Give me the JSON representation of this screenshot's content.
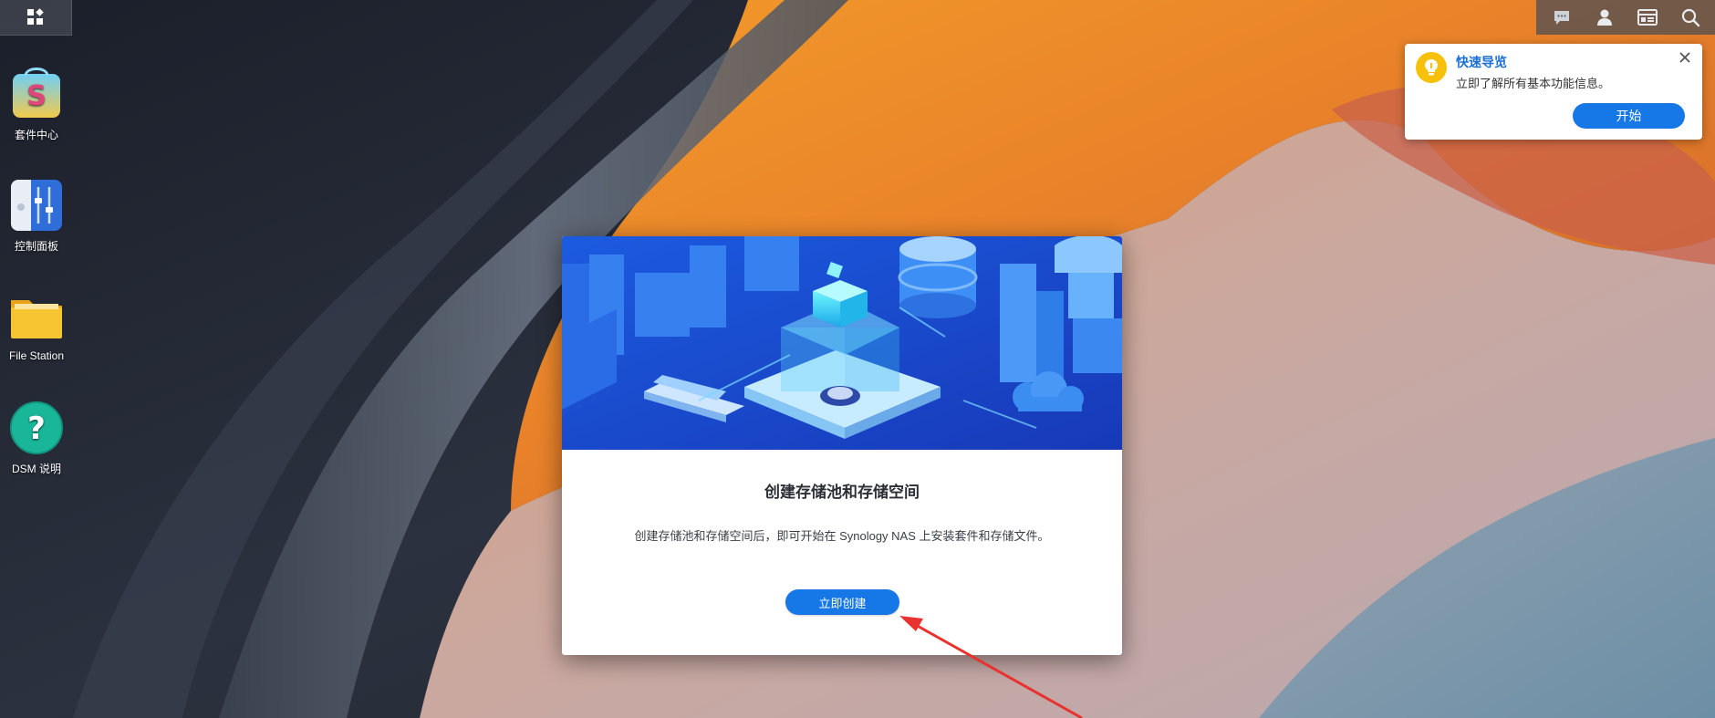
{
  "desktop": {
    "shortcuts": [
      {
        "label": "套件中心",
        "icon": "package-center-icon"
      },
      {
        "label": "控制面板",
        "icon": "control-panel-icon"
      },
      {
        "label": "File Station",
        "icon": "folder-icon"
      },
      {
        "label": "DSM 说明",
        "icon": "help-icon"
      }
    ]
  },
  "taskbar": {
    "main_menu_icon": "main-menu-icon",
    "tray_icons": [
      "notification-icon",
      "user-icon",
      "widgets-icon",
      "search-icon"
    ]
  },
  "quick_guide": {
    "title": "快速导览",
    "description": "立即了解所有基本功能信息。",
    "start_button": "开始",
    "close_icon": "close-icon"
  },
  "storage_dialog": {
    "title": "创建存储池和存储空间",
    "description": "创建存储池和存储空间后，即可开始在 Synology NAS 上安装套件和存储文件。",
    "create_button": "立即创建"
  },
  "colors": {
    "accent_blue": "#1677e6",
    "guide_title_blue": "#1a6fd6",
    "bulb_yellow": "#f7c10a",
    "annotation_arrow": "#e8322f"
  }
}
